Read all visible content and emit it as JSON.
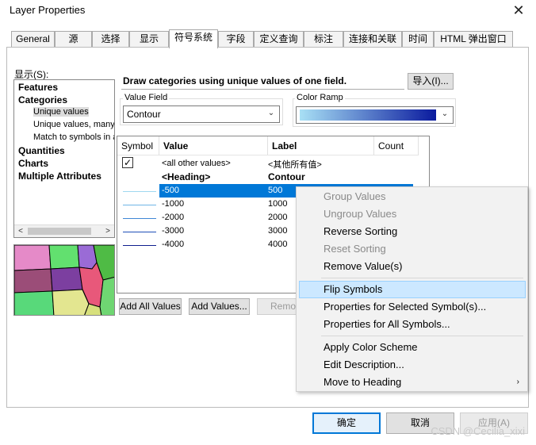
{
  "window": {
    "title": "Layer Properties"
  },
  "tabs": [
    "General",
    "源",
    "选择",
    "显示",
    "符号系统",
    "字段",
    "定义查询",
    "标注",
    "连接和关联",
    "时间",
    "HTML 弹出窗口"
  ],
  "active_tab_index": 4,
  "show_label": "显示(S):",
  "tree": {
    "items": [
      {
        "label": "Features",
        "bold": true
      },
      {
        "label": "Categories",
        "bold": true
      },
      {
        "label": "Unique values",
        "sub": true,
        "selected": true
      },
      {
        "label": "Unique values, many",
        "sub": true
      },
      {
        "label": "Match to symbols in a",
        "sub": true
      },
      {
        "label": "Quantities",
        "bold": true
      },
      {
        "label": "Charts",
        "bold": true
      },
      {
        "label": "Multiple Attributes",
        "bold": true
      }
    ],
    "scroll_left": "<",
    "scroll_right": ">"
  },
  "description": "Draw categories using unique values of one field.",
  "import_button": "导入(I)...",
  "value_field": {
    "label": "Value Field",
    "value": "Contour"
  },
  "color_ramp": {
    "label": "Color Ramp",
    "start": "#a8e0f5",
    "end": "#0a1a9e"
  },
  "table": {
    "headers": {
      "symbol": "Symbol",
      "value": "Value",
      "label": "Label",
      "count": "Count"
    },
    "all_other": {
      "value": "<all other values>",
      "label": "<其他所有值>",
      "checked": true
    },
    "heading": {
      "value": "<Heading>",
      "label": "Contour"
    },
    "rows": [
      {
        "value": "-500",
        "label": "500",
        "color": "#9fd8f0",
        "selected": true
      },
      {
        "value": "-1000",
        "label": "1000",
        "color": "#6fb6e6"
      },
      {
        "value": "-2000",
        "label": "2000",
        "color": "#3f86d6"
      },
      {
        "value": "-3000",
        "label": "3000",
        "color": "#1f4fb8"
      },
      {
        "value": "-4000",
        "label": "4000",
        "color": "#101f8e"
      }
    ]
  },
  "buttons": {
    "add_all": "Add All Values",
    "add_values": "Add Values...",
    "remove": "Remove",
    "ok": "确定",
    "cancel": "取消",
    "apply": "应用(A)"
  },
  "context_menu": {
    "items": [
      {
        "label": "Group Values",
        "disabled": true
      },
      {
        "label": "Ungroup Values",
        "disabled": true
      },
      {
        "label": "Reverse Sorting"
      },
      {
        "label": "Reset Sorting",
        "disabled": true
      },
      {
        "label": "Remove Value(s)"
      },
      {
        "separator": true
      },
      {
        "label": "Flip Symbols",
        "hover": true
      },
      {
        "label": "Properties for Selected Symbol(s)..."
      },
      {
        "label": "Properties for All Symbols..."
      },
      {
        "separator": true
      },
      {
        "label": "Apply Color Scheme"
      },
      {
        "label": "Edit Description..."
      },
      {
        "label": "Move to Heading",
        "submenu": true
      }
    ],
    "submenu_arrow": "›"
  },
  "close_glyph": "✕",
  "checkbox_glyph": "✓",
  "dropdown_glyph": "⌄",
  "watermark": "CSDN @Cecilia_xixi"
}
